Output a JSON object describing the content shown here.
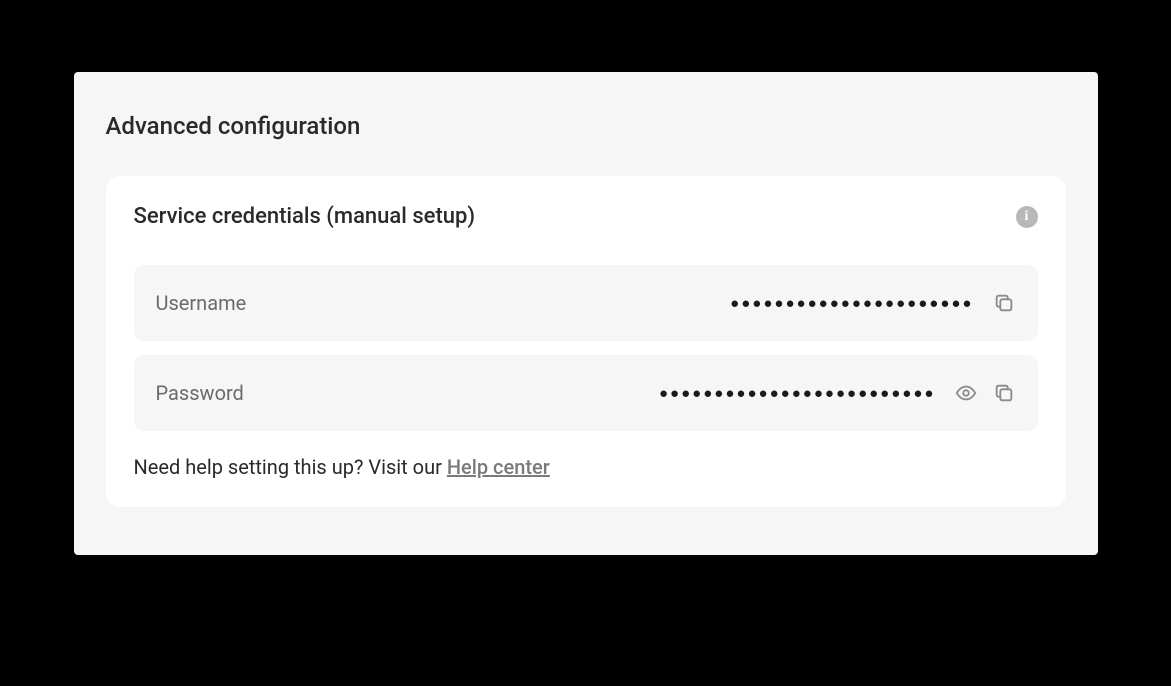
{
  "section": {
    "title": "Advanced configuration"
  },
  "card": {
    "title": "Service credentials (manual setup)"
  },
  "fields": {
    "username": {
      "label": "Username",
      "masked": "●●●●●●●●●●●●●●●●●●●●●●"
    },
    "password": {
      "label": "Password",
      "masked": "●●●●●●●●●●●●●●●●●●●●●●●●●"
    }
  },
  "help": {
    "text": "Need help setting this up? Visit our ",
    "link_label": "Help center"
  }
}
